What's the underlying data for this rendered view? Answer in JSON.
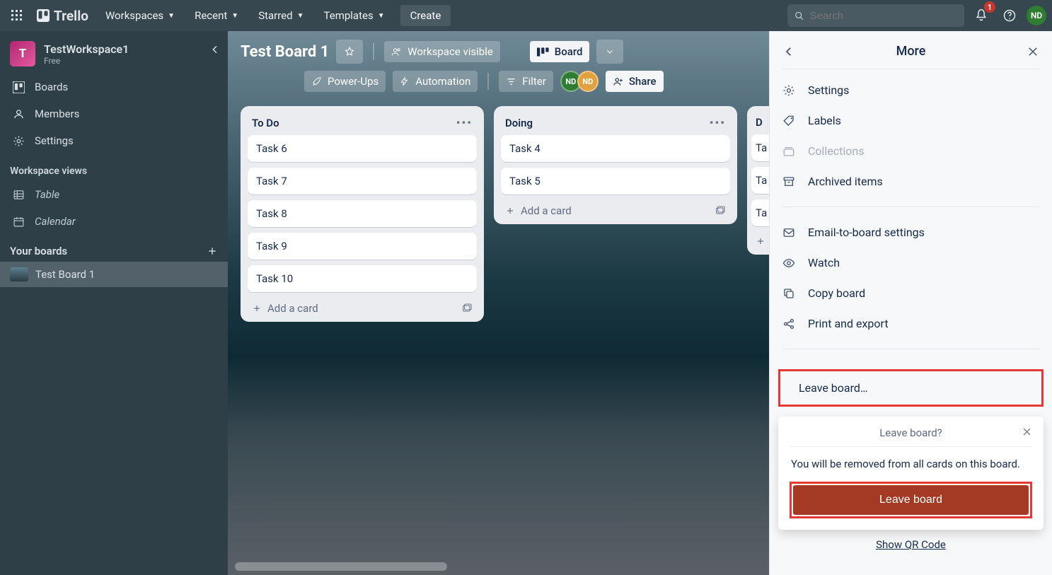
{
  "header": {
    "logo_text": "Trello",
    "nav": {
      "workspaces": "Workspaces",
      "recent": "Recent",
      "starred": "Starred",
      "templates": "Templates"
    },
    "create_label": "Create",
    "search_placeholder": "Search",
    "notification_count": "1",
    "profile_initials": "ND"
  },
  "sidebar": {
    "workspace_name": "TestWorkspace1",
    "workspace_plan": "Free",
    "items": {
      "boards": "Boards",
      "members": "Members",
      "settings": "Settings"
    },
    "views_header": "Workspace views",
    "views": {
      "table": "Table",
      "calendar": "Calendar"
    },
    "your_boards_header": "Your boards",
    "board_item": "Test Board 1"
  },
  "board": {
    "title": "Test Board 1",
    "visibility_label": "Workspace visible",
    "view_label": "Board",
    "powerups_label": "Power-Ups",
    "automation_label": "Automation",
    "filter_label": "Filter",
    "share_label": "Share",
    "member1": "ND",
    "member2": "ND",
    "lists": [
      {
        "title": "To Do",
        "cards": [
          "Task 6",
          "Task 7",
          "Task 8",
          "Task 9",
          "Task 10"
        ],
        "add": "Add a card"
      },
      {
        "title": "Doing",
        "cards": [
          "Task 4",
          "Task 5"
        ],
        "add": "Add a card"
      },
      {
        "title": "D",
        "cards": [
          "Ta",
          "Ta",
          "Ta"
        ]
      }
    ]
  },
  "panel": {
    "title": "More",
    "items": {
      "settings": "Settings",
      "labels": "Labels",
      "collections": "Collections",
      "archived": "Archived items",
      "email": "Email-to-board settings",
      "watch": "Watch",
      "copy": "Copy board",
      "print": "Print and export"
    },
    "leave_row": "Leave board…",
    "popover_title": "Leave board?",
    "popover_text": "You will be removed from all cards on this board.",
    "leave_button": "Leave board",
    "qr_link": "Show QR Code"
  }
}
